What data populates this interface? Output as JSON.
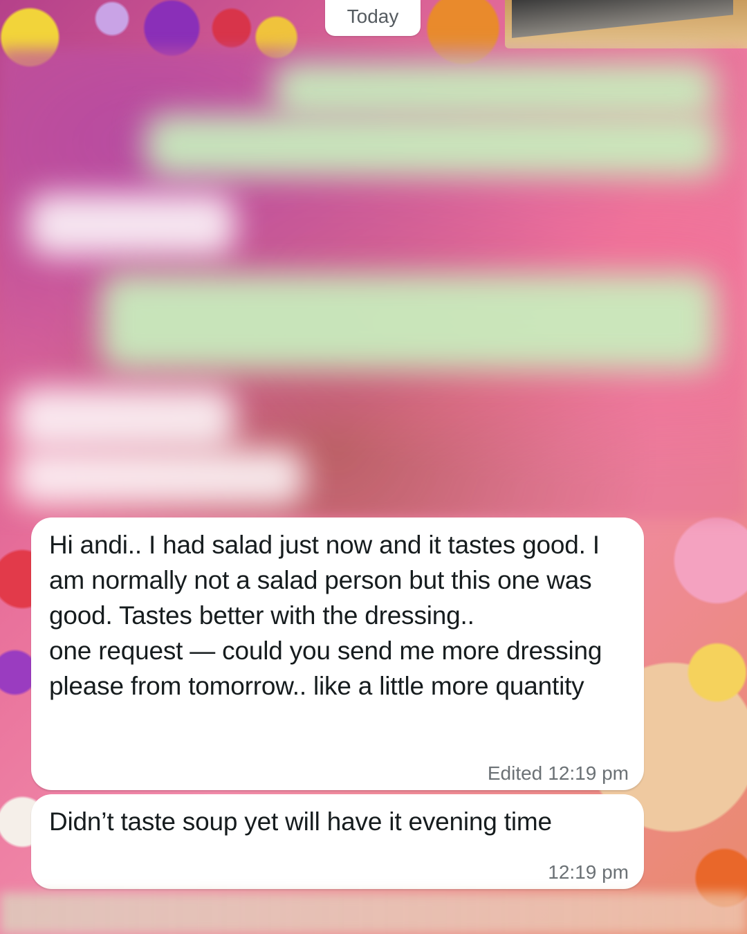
{
  "chat": {
    "date_separator": "Today",
    "messages": [
      {
        "text": "Hi andi.. I had salad just now and it tastes good. I am normally not a salad person but this one was good. Tastes better with the dressing..\none request — could you send me more dressing please from tomorrow.. like a little more quantity",
        "edited_label": "Edited",
        "time": "12:19 pm"
      },
      {
        "text": "Didn’t taste soup yet will have it evening time",
        "time": "12:19 pm"
      }
    ]
  },
  "colors": {
    "incoming_bubble": "#ffffff",
    "outgoing_bubble_blurred": "#c8f0be",
    "meta_text": "#6b7175",
    "message_text": "#161c1e"
  }
}
